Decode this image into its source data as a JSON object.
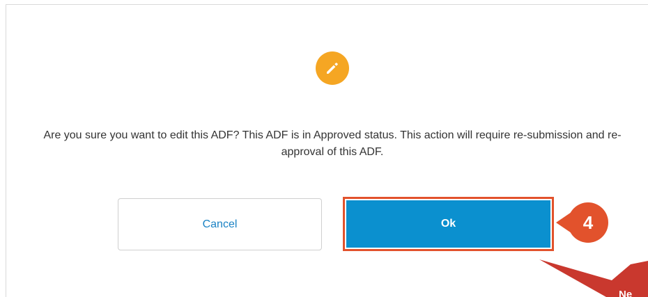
{
  "dialog": {
    "icon": "pencil-icon",
    "message": "Are you sure you want to edit this ADF? This ADF is in Approved status. This action will require re-submission and re-approval of this ADF.",
    "cancel_label": "Cancel",
    "ok_label": "Ok"
  },
  "annotation": {
    "step_number": "4",
    "callout_text": "Ne"
  },
  "colors": {
    "icon_bg": "#f5a623",
    "ok_button": "#0b90cf",
    "cancel_text": "#1a82c4",
    "highlight": "#e2522c",
    "callout": "#c9382e"
  }
}
